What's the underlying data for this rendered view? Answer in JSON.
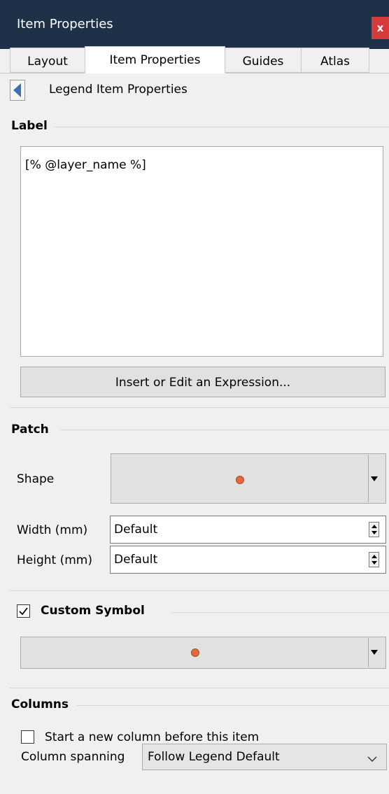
{
  "window": {
    "title": "Item Properties",
    "close_label": "x"
  },
  "tabs": [
    {
      "label": "Layout",
      "active": false
    },
    {
      "label": "Item Properties",
      "active": true
    },
    {
      "label": "Guides",
      "active": false
    },
    {
      "label": "Atlas",
      "active": false
    }
  ],
  "panel": {
    "back_label": "Legend Item Properties"
  },
  "label_section": {
    "title": "Label",
    "text_value": "[% @layer_name %]",
    "expression_button": "Insert or Edit an Expression..."
  },
  "patch_section": {
    "title": "Patch",
    "shape_label": "Shape",
    "width_label": "Width (mm)",
    "width_value": "Default",
    "height_label": "Height (mm)",
    "height_value": "Default",
    "symbol_color": "#e06a3c"
  },
  "custom_symbol": {
    "label": "Custom Symbol",
    "checked": true
  },
  "columns_section": {
    "title": "Columns",
    "new_column_label": "Start a new column before this item",
    "new_column_checked": false,
    "spanning_label": "Column spanning",
    "spanning_value": "Follow Legend Default"
  },
  "colors": {
    "titlebar": "#1e3148",
    "close": "#d43a3a",
    "background": "#f0f0f0"
  }
}
